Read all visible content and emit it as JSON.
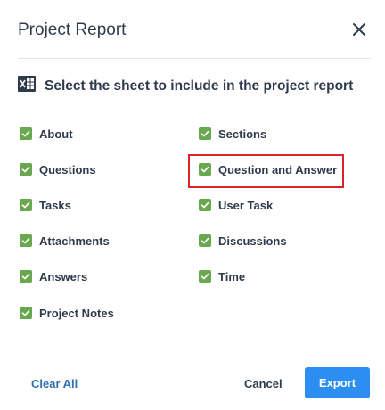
{
  "dialog": {
    "title": "Project Report",
    "close_icon": "close-icon"
  },
  "prompt": {
    "icon": "excel-sheet-icon",
    "text": "Select the sheet to include in the project report"
  },
  "options": [
    {
      "label": "About",
      "checked": true
    },
    {
      "label": "Sections",
      "checked": true
    },
    {
      "label": "Questions",
      "checked": true
    },
    {
      "label": "Question and Answer",
      "checked": true
    },
    {
      "label": "Tasks",
      "checked": true
    },
    {
      "label": "User Task",
      "checked": true
    },
    {
      "label": "Attachments",
      "checked": true
    },
    {
      "label": "Discussions",
      "checked": true
    },
    {
      "label": "Answers",
      "checked": true
    },
    {
      "label": "Time",
      "checked": true
    },
    {
      "label": "Project Notes",
      "checked": true
    }
  ],
  "footer": {
    "clear_label": "Clear All",
    "cancel_label": "Cancel",
    "export_label": "Export"
  },
  "colors": {
    "checkbox": "#6aa84f",
    "primary": "#2b8ef0",
    "link": "#2c6fb3",
    "highlight": "#d9232d"
  }
}
